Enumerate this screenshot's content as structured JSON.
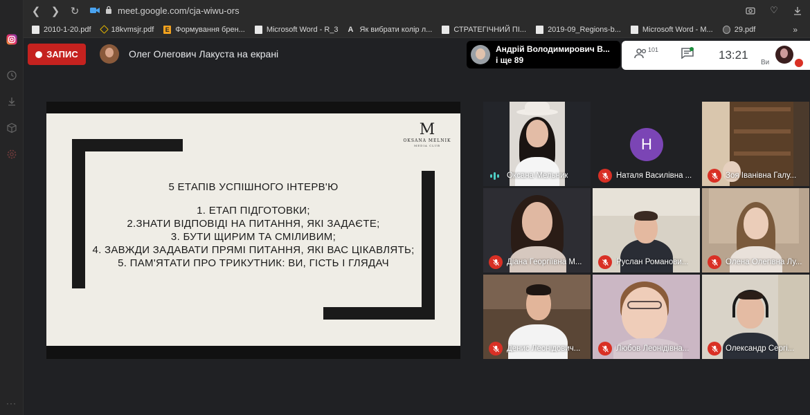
{
  "browser": {
    "url": "meet.google.com/cja-wiwu-ors"
  },
  "bookmarks": [
    "2010-1-20.pdf",
    "18kvmsjr.pdf",
    "Формування брен...",
    "Microsoft Word - R_3",
    "Як вибрати колір л...",
    "СТРАТЕГІЧНИЙ ПІ...",
    "2019-09_Regions-b...",
    "Microsoft Word - M...",
    "29.pdf"
  ],
  "bookmarks_more": "»",
  "meet": {
    "record_label": "ЗАПИС",
    "presenter_text": "Олег Олегович Лакуста на екрані",
    "speaker_name": "Андрій Володимирович В...",
    "speaker_more": "і ще 89",
    "people_count": "101",
    "clock": "13:21",
    "self_label": "Ви"
  },
  "slide": {
    "logo_mark": "M",
    "logo_name": "OKSANA MELNIK",
    "logo_sub": "MEDIA CLUB",
    "title": "5 ЕТАПІВ УСПІШНОГО ІНТЕРВ'Ю",
    "items": [
      "1. ЕТАП ПІДГОТОВКИ;",
      "2.ЗНАТИ ВІДПОВІДІ НА ПИТАННЯ, ЯКІ ЗАДАЄТЕ;",
      "3. БУТИ ЩИРИМ ТА СМІЛИВИМ;",
      "4. ЗАВЖДИ ЗАДАВАТИ ПРЯМІ ПИТАННЯ, ЯКІ ВАС ЦІКАВЛЯТЬ;",
      "5. ПАМ'ЯТАТИ ПРО ТРИКУТНИК: ВИ, ГІСТЬ І ГЛЯДАЧ"
    ]
  },
  "participants": [
    {
      "name": "Оксана Мельник",
      "speaking": true
    },
    {
      "name": "Наталя Василівна ...",
      "initial": "H"
    },
    {
      "name": "Зоя Іванівна Галу..."
    },
    {
      "name": "Діана Георгіївна М..."
    },
    {
      "name": "Руслан Романови..."
    },
    {
      "name": "Олена Олегівна Лу..."
    },
    {
      "name": "Денис Леонідович..."
    },
    {
      "name": "Любов Леонідівна..."
    },
    {
      "name": "Олександр Сергі..."
    }
  ],
  "colors": {
    "record": "#c5221f",
    "mic_muted": "#d93025",
    "avatar_initial": "#7b45b5",
    "speaking": "#4ecdc4"
  }
}
